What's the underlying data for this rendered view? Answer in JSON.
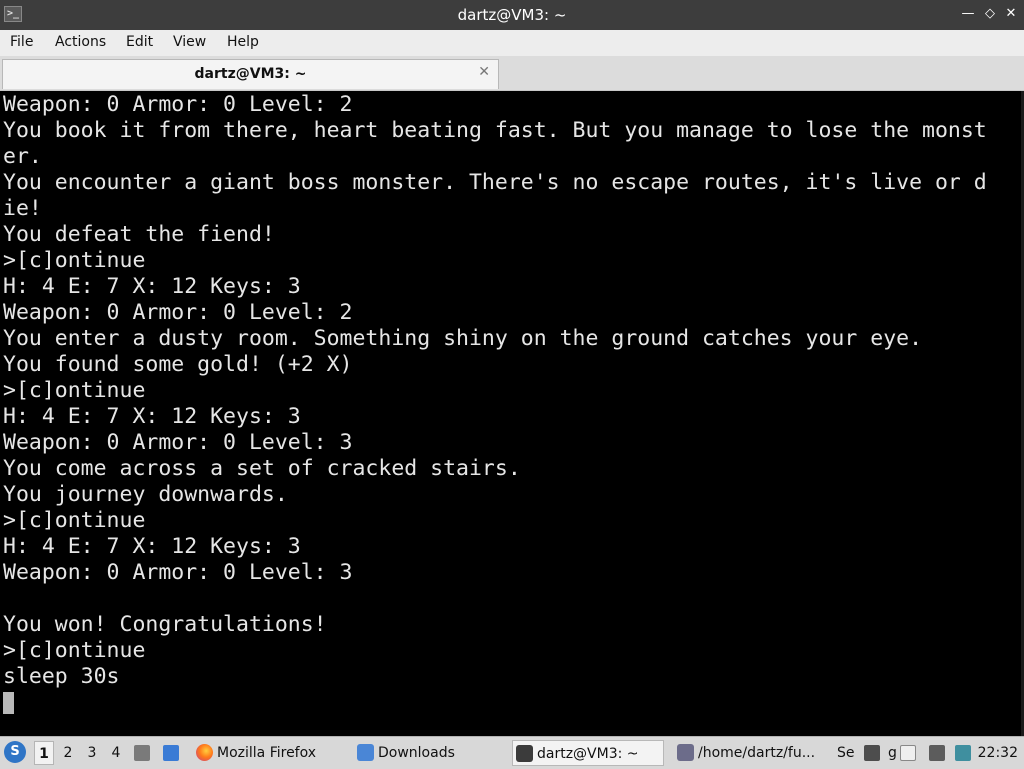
{
  "window": {
    "title": "dartz@VM3: ~",
    "app_icon_glyph": ">_",
    "minimize_glyph": "—",
    "maximize_glyph": "◇",
    "close_glyph": "✕"
  },
  "menu": [
    "File",
    "Actions",
    "Edit",
    "View",
    "Help"
  ],
  "tab": {
    "label": "dartz@VM3: ~",
    "close_glyph": "✕"
  },
  "terminal": {
    "lines": [
      "Weapon: 0 Armor: 0 Level: 2",
      "You book it from there, heart beating fast. But you manage to lose the monst",
      "er.",
      "You encounter a giant boss monster. There's no escape routes, it's live or d",
      "ie!",
      "You defeat the fiend!",
      ">[c]ontinue",
      "H: 4 E: 7 X: 12 Keys: 3",
      "Weapon: 0 Armor: 0 Level: 2",
      "You enter a dusty room. Something shiny on the ground catches your eye.",
      "You found some gold! (+2 X)",
      ">[c]ontinue",
      "H: 4 E: 7 X: 12 Keys: 3",
      "Weapon: 0 Armor: 0 Level: 3",
      "You come across a set of cracked stairs.",
      "You journey downwards.",
      ">[c]ontinue",
      "H: 4 E: 7 X: 12 Keys: 3",
      "Weapon: 0 Armor: 0 Level: 3",
      "",
      "You won! Congratulations!",
      ">[c]ontinue",
      "sleep 30s"
    ]
  },
  "taskbar": {
    "start_glyph": "S",
    "workspaces": [
      "1",
      "2",
      "3",
      "4"
    ],
    "active_workspace": "1",
    "tasks": [
      {
        "label": "Mozilla Firefox",
        "icon": "firefox-icon"
      },
      {
        "label": "Downloads",
        "icon": "folder-icon"
      },
      {
        "label": "dartz@VM3: ~",
        "icon": "terminal-icon"
      },
      {
        "label": "/home/dartz/fu...",
        "icon": "editor-icon"
      }
    ],
    "tray_partial_text": [
      "Se",
      "g"
    ],
    "clock": "22:32"
  },
  "colors": {
    "titlebar": "#3d3d3d",
    "terminal_bg": "#000000",
    "terminal_fg": "#e6e6e6",
    "taskbar": "#d8d8d8"
  }
}
